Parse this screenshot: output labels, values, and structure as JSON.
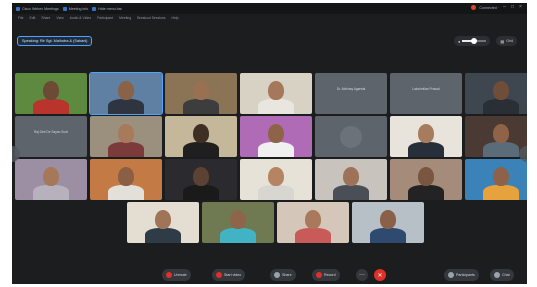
{
  "titlebar": {
    "app_title": "Cisco Webex Meetings",
    "tab_meeting_info": "Meeting info",
    "tab_hide": "Hide menu bar",
    "user_label": "Connected ·",
    "min_glyph": "–",
    "max_glyph": "□",
    "close_glyph": "×"
  },
  "menubar": {
    "items": [
      "File",
      "Edit",
      "Share",
      "View",
      "Audio & Video",
      "Participant",
      "Meeting",
      "Breakout Sessions",
      "Help"
    ]
  },
  "speaking": {
    "label": "Speaking: Rir Sgt. Malhotra & (Sahani)"
  },
  "view_controls": {
    "layout_label": "Grid",
    "slider_level": 0.5
  },
  "tiles": [
    {
      "kind": "video",
      "bg": "#5d8a3f",
      "skin": "#6b4a36",
      "shirt": "#b8342c"
    },
    {
      "kind": "video",
      "bg": "#5f7fa3",
      "skin": "#8a6247",
      "shirt": "#2e3440",
      "speaker": true
    },
    {
      "kind": "video",
      "bg": "#8b7355",
      "skin": "#9a7052",
      "shirt": "#3d3d3d"
    },
    {
      "kind": "video",
      "bg": "#d8d2c4",
      "skin": "#a5785c",
      "shirt": "#e9e6df"
    },
    {
      "kind": "name",
      "name": "Dr. Abhinay Agarwal",
      "sub": ""
    },
    {
      "kind": "name",
      "name": "Lakshmikar Prasad",
      "sub": ""
    },
    {
      "kind": "video",
      "bg": "#3e4650",
      "skin": "#6f4d38",
      "shirt": "#2a2f36"
    },
    {
      "kind": "name",
      "name": "Raj Deb De Sayan Sudr",
      "sub": ""
    },
    {
      "kind": "video",
      "bg": "#9b8f7e",
      "skin": "#a87a5c",
      "shirt": "#7c3b3b"
    },
    {
      "kind": "video",
      "bg": "#c4b79a",
      "skin": "#3f2e24",
      "shirt": "#1f1f1f"
    },
    {
      "kind": "video",
      "bg": "#b06bb6",
      "skin": "#8e6448",
      "shirt": "#f0f0f0"
    },
    {
      "kind": "circle"
    },
    {
      "kind": "video",
      "bg": "#e8e4dc",
      "skin": "#a77b5e",
      "shirt": "#27303a"
    },
    {
      "kind": "video",
      "bg": "#4b3a33",
      "skin": "#8f6347",
      "shirt": "#5a6b7a"
    },
    {
      "kind": "video",
      "bg": "#9d8fa3",
      "skin": "#a5785a",
      "shirt": "#b7b0bd"
    },
    {
      "kind": "video",
      "bg": "#c47a45",
      "skin": "#8a5f43",
      "shirt": "#e3e0da"
    },
    {
      "kind": "video",
      "bg": "#2b2a2e",
      "skin": "#5c4232",
      "shirt": "#1a1a1a"
    },
    {
      "kind": "video",
      "bg": "#e7e2d8",
      "skin": "#b58563",
      "shirt": "#d8d6d0"
    },
    {
      "kind": "video",
      "bg": "#c8c3bc",
      "skin": "#9d7258",
      "shirt": "#4a4f57"
    },
    {
      "kind": "video",
      "bg": "#a58c7a",
      "skin": "#7a5540",
      "shirt": "#232323"
    },
    {
      "kind": "video",
      "bg": "#3a82b8",
      "skin": "#8d6248",
      "shirt": "#e6a23c"
    },
    {
      "kind": "video",
      "bg": "#e3ddd2",
      "skin": "#9f7457",
      "shirt": "#2f3b46"
    },
    {
      "kind": "video",
      "bg": "#6f7a52",
      "skin": "#8e654a",
      "shirt": "#41b3c4"
    },
    {
      "kind": "video",
      "bg": "#d4c6b8",
      "skin": "#a8795b",
      "shirt": "#c85a5a"
    },
    {
      "kind": "video",
      "bg": "#b7bfc7",
      "skin": "#8a6048",
      "shirt": "#2e4a6e"
    }
  ],
  "controls": {
    "unmute": "Unmute",
    "start_video": "Start video",
    "share": "Share",
    "record": "Record",
    "more_glyph": "···",
    "end_glyph": "✕",
    "participants": "Participants",
    "chat": "Chat"
  },
  "colors": {
    "accent": "#4fa3ff",
    "end_call": "#e0302a",
    "window_bg": "#1c1d1f"
  }
}
